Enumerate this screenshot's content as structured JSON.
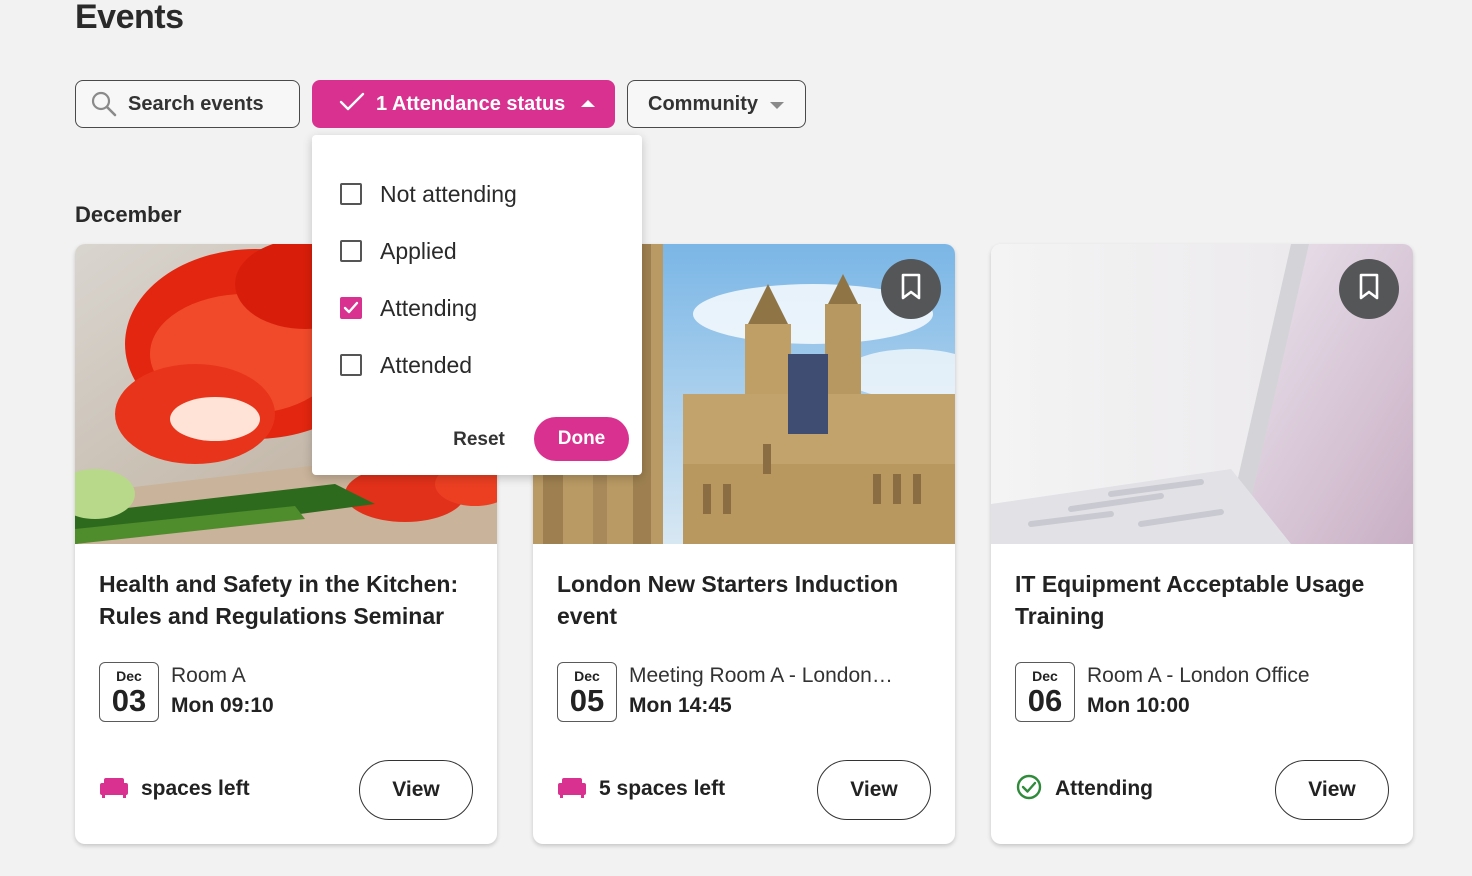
{
  "page": {
    "title": "Events"
  },
  "filters": {
    "search_placeholder": "Search events",
    "status_label": "1 Attendance status",
    "community_label": "Community"
  },
  "dropdown": {
    "options": [
      {
        "label": "Not attending",
        "checked": false
      },
      {
        "label": "Applied",
        "checked": false
      },
      {
        "label": "Attending",
        "checked": true
      },
      {
        "label": "Attended",
        "checked": false
      }
    ],
    "reset_label": "Reset",
    "done_label": "Done"
  },
  "month": "December",
  "cards": [
    {
      "title": "Health and Safety in the Kitchen: Rules and Regulations Seminar",
      "month": "Dec",
      "day": "03",
      "location": "Room A",
      "time": "Mon 09:10",
      "status": "spaces left",
      "status_icon": "sofa-icon",
      "view_label": "View"
    },
    {
      "title": "London New Starters Induction event",
      "month": "Dec",
      "day": "05",
      "location": "Meeting Room A - London…",
      "time": "Mon 14:45",
      "status": "5 spaces left",
      "status_icon": "sofa-icon",
      "view_label": "View"
    },
    {
      "title": "IT Equipment Acceptable Usage Training",
      "month": "Dec",
      "day": "06",
      "location": "Room A - London Office",
      "time": "Mon 10:00",
      "status": "Attending",
      "status_icon": "check-circle-icon",
      "view_label": "View"
    }
  ],
  "colors": {
    "accent": "#d9318f",
    "success": "#2e8b3a",
    "bookmark_bg": "#555658"
  }
}
